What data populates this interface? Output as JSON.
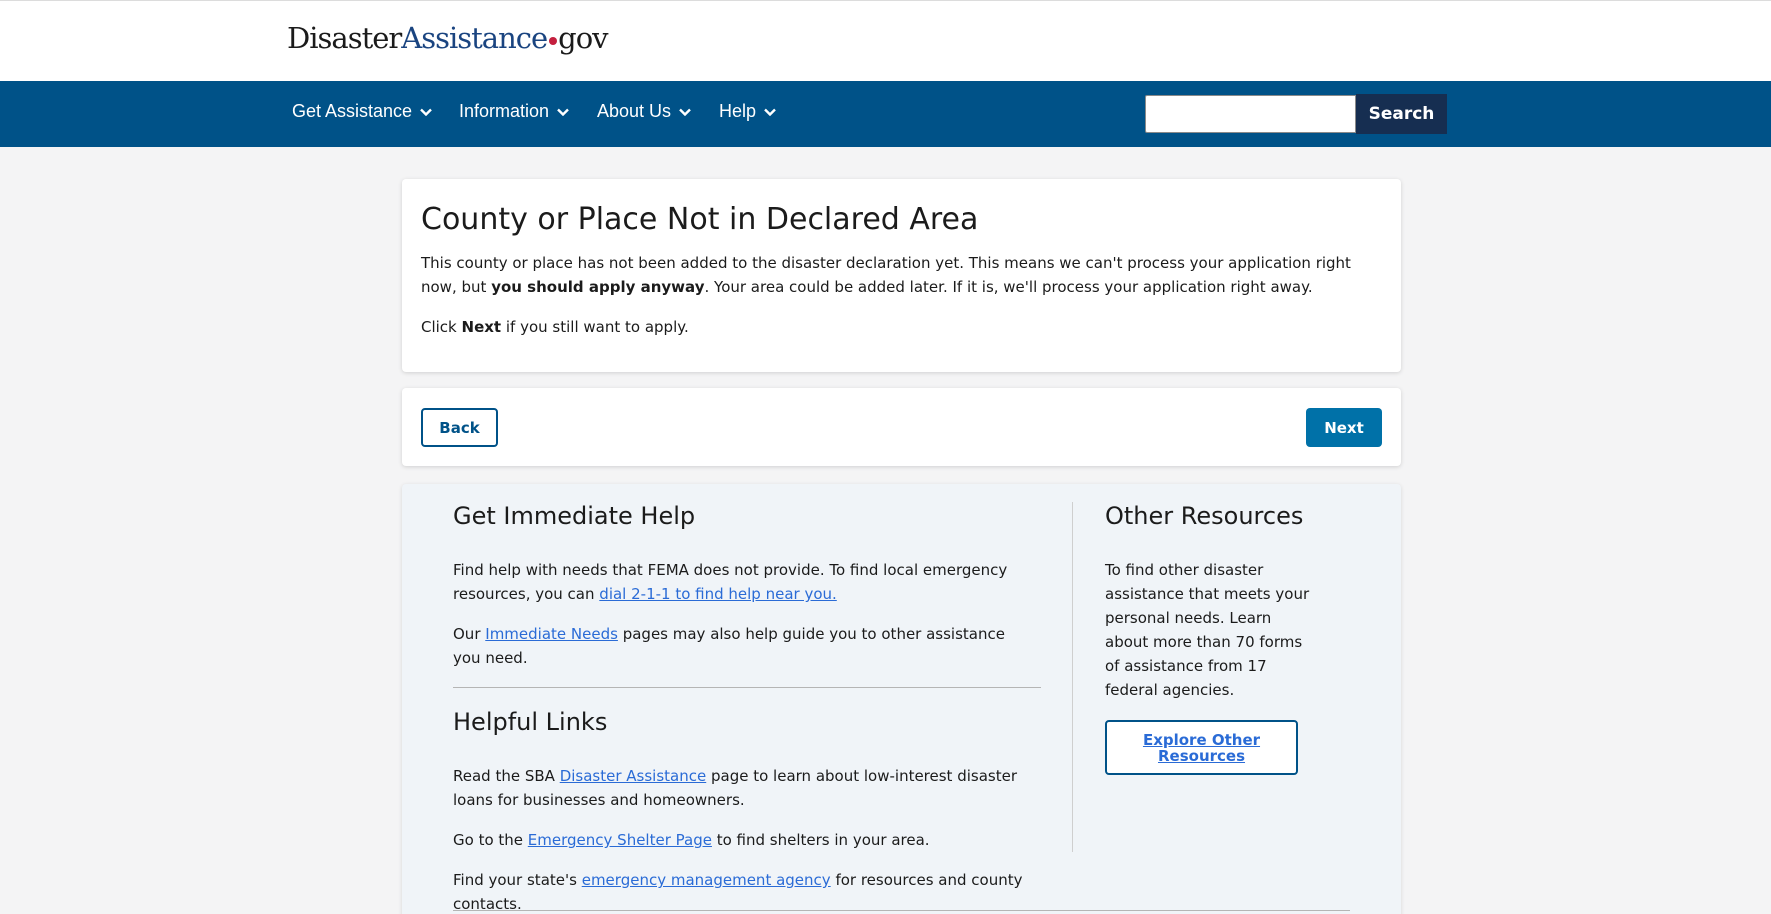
{
  "header": {
    "logo_part1": "Disaster",
    "logo_part2": "Assistance",
    "logo_part3": "gov"
  },
  "nav": {
    "items": [
      {
        "label": "Get Assistance"
      },
      {
        "label": "Information"
      },
      {
        "label": "About Us"
      },
      {
        "label": "Help"
      }
    ],
    "search_value": "",
    "search_button": "Search"
  },
  "main": {
    "title": "County or Place Not in Declared Area",
    "para1_a": "This county or place has not been added to the disaster declaration yet. This means we can't process your application right now, but",
    "para1_bold": "you should apply anyway",
    "para1_b": ". Your area could be added later. If it is, we'll process your application right away.",
    "para2_a": "Click",
    "para2_bold": "Next",
    "para2_b": "if you still want to apply."
  },
  "buttons": {
    "back": "Back",
    "next": "Next"
  },
  "immediate_help": {
    "heading": "Get Immediate Help",
    "p1_text": "Find help with needs that FEMA does not provide. To find local emergency resources, you can",
    "p1_link": "dial 2-1-1 to find help near you.",
    "p2_a": "Our",
    "p2_link": "Immediate Needs",
    "p2_b": "pages may also help guide you to other assistance you need."
  },
  "helpful_links": {
    "heading": "Helpful Links",
    "p1_a": "Read the SBA",
    "p1_link": "Disaster Assistance",
    "p1_b": "page to learn about low-interest disaster loans for businesses and homeowners.",
    "p2_a": "Go to the",
    "p2_link": "Emergency Shelter Page",
    "p2_b": "to find shelters in your area.",
    "p3_a": "Find your state's",
    "p3_link": "emergency management agency",
    "p3_b": "for resources and county contacts."
  },
  "other_resources": {
    "heading": "Other Resources",
    "text": "To find other disaster assistance that meets your personal needs. Learn about more than 70 forms of assistance from 17 federal agencies.",
    "button": "Explore Other Resources"
  },
  "colors": {
    "nav_bg": "#005288",
    "search_btn_bg": "#162e51",
    "next_btn_bg": "#0071a8",
    "link": "#2a6bd6",
    "logo_accent": "#1a4480",
    "logo_dot": "#c41f3e"
  },
  "icons": {
    "nav_chevron": "chevron-down-icon"
  }
}
